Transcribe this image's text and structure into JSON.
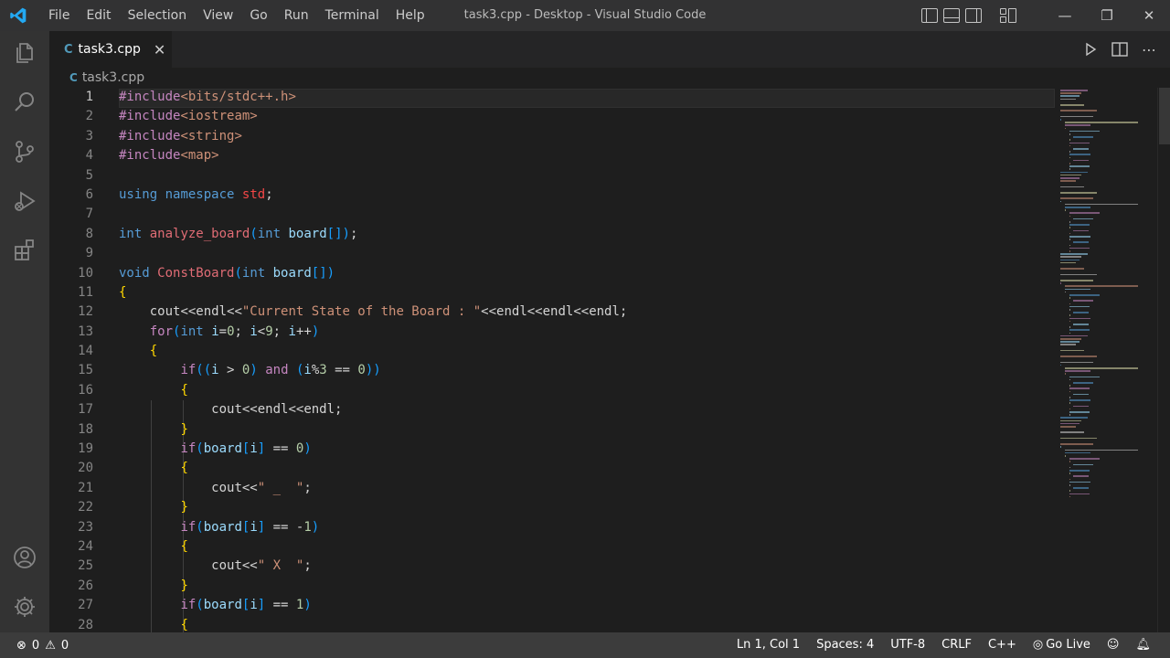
{
  "titlebar": {
    "menu": [
      "File",
      "Edit",
      "Selection",
      "View",
      "Go",
      "Run",
      "Terminal",
      "Help"
    ],
    "window_title": "task3.cpp - Desktop - Visual Studio Code"
  },
  "tab": {
    "label": "task3.cpp"
  },
  "breadcrumb": {
    "label": "task3.cpp"
  },
  "editor": {
    "line_numbers": [
      "1",
      "2",
      "3",
      "4",
      "5",
      "6",
      "7",
      "8",
      "9",
      "10",
      "11",
      "12",
      "13",
      "14",
      "15",
      "16",
      "17",
      "18",
      "19",
      "20",
      "21",
      "22",
      "23",
      "24",
      "25",
      "26",
      "27",
      "28"
    ],
    "lines": [
      "#include<bits/stdc++.h>",
      "#include<iostream>",
      "#include<string>",
      "#include<map>",
      "",
      "using namespace std;",
      "",
      "int analyze_board(int board[]);",
      "",
      "void ConstBoard(int board[])",
      "{",
      "    cout<<endl<<\"Current State of the Board : \"<<endl<<endl<<endl;",
      "    for(int i=0; i<9; i++)",
      "    {",
      "        if((i > 0) and (i%3 == 0))",
      "        {",
      "            cout<<endl<<endl;",
      "        }",
      "        if(board[i] == 0)",
      "        {",
      "            cout<<\" _  \";",
      "        }",
      "        if(board[i] == -1)",
      "        {",
      "            cout<<\" X  \";",
      "        }",
      "        if(board[i] == 1)",
      "        {"
    ]
  },
  "statusbar": {
    "errors": "0",
    "warnings": "0",
    "position": "Ln 1, Col 1",
    "spaces": "Spaces: 4",
    "encoding": "UTF-8",
    "eol": "CRLF",
    "language": "C++",
    "golive": "Go Live"
  },
  "icons": {
    "activity": [
      "files-icon",
      "search-icon",
      "source-control-icon",
      "run-debug-icon",
      "extensions-icon",
      "account-icon",
      "settings-gear-icon"
    ]
  },
  "colors": {
    "accent": "#007acc",
    "statusbar_bg": "#3c3c3c",
    "editor_bg": "#1e1e1e"
  }
}
